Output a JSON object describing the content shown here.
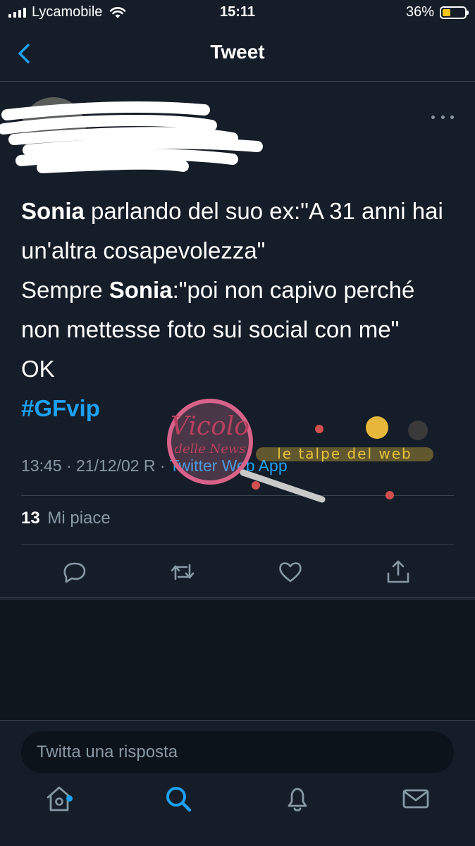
{
  "status_bar": {
    "carrier": "Lycamobile",
    "time": "15:11",
    "battery_percent": "36%",
    "battery_level": 0.36
  },
  "header": {
    "title": "Tweet"
  },
  "tweet": {
    "segments": [
      {
        "text": "Sonia",
        "style": "bold"
      },
      {
        "text": " parlando del suo ex:\"A 31 anni hai un'altra cosapevolezza\"",
        "style": "normal"
      },
      {
        "text": "Sempre ",
        "style": "normal"
      },
      {
        "text": "Sonia",
        "style": "bold"
      },
      {
        "text": ":\"poi non capivo perché non mettesse foto sui social con me\"",
        "style": "normal"
      },
      {
        "text": "OK",
        "style": "normal"
      },
      {
        "text": "#GFvip",
        "style": "hashtag"
      }
    ],
    "timestamp": "13:45 · 21/12/02 R · ",
    "source": "Twitter Web App",
    "likes_count": "13",
    "likes_label": "Mi piace"
  },
  "reply": {
    "placeholder": "Twitta una risposta"
  },
  "watermark": {
    "logo_text": "Vicolo delle News",
    "overlay_text": "le talpe del web"
  },
  "colors": {
    "background": "#151d28",
    "accent": "#1da1f2",
    "muted": "#8899a6",
    "divider": "#38444d",
    "battery": "#f5c518"
  },
  "icons": [
    "back-chevron-icon",
    "more-icon",
    "reply-icon",
    "retweet-icon",
    "like-icon",
    "share-icon",
    "home-icon",
    "search-icon",
    "notifications-icon",
    "messages-icon"
  ]
}
